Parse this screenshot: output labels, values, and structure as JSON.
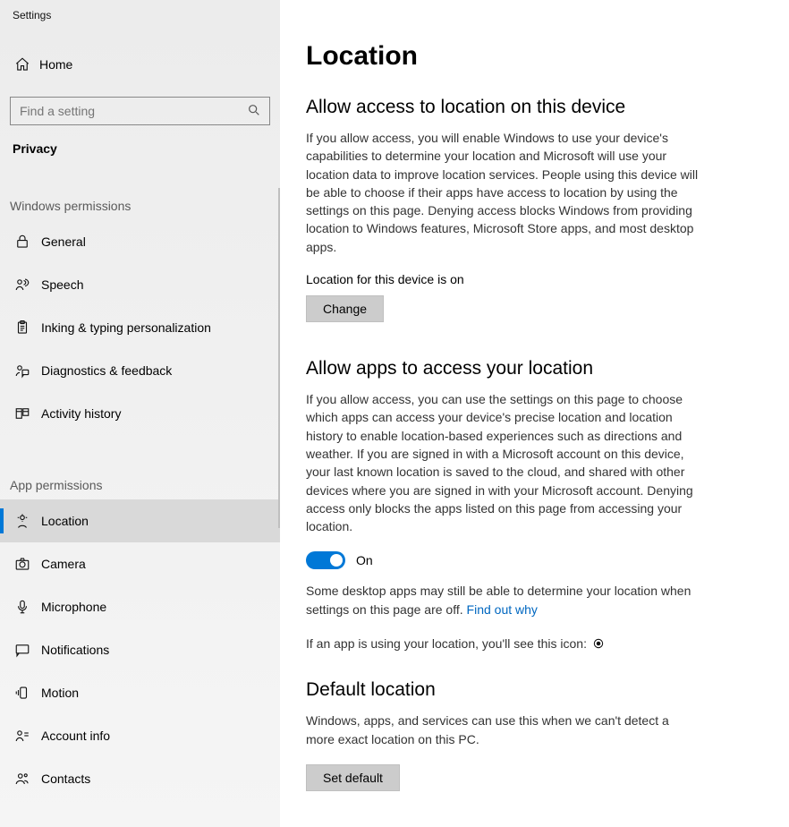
{
  "app_title": "Settings",
  "home_label": "Home",
  "search_placeholder": "Find a setting",
  "current_page": "Privacy",
  "groups": {
    "windows_permissions": {
      "header": "Windows permissions",
      "items": [
        "General",
        "Speech",
        "Inking & typing personalization",
        "Diagnostics & feedback",
        "Activity history"
      ]
    },
    "app_permissions": {
      "header": "App permissions",
      "items": [
        "Location",
        "Camera",
        "Microphone",
        "Notifications",
        "Motion",
        "Account info",
        "Contacts"
      ]
    }
  },
  "selected_item": "Location",
  "page": {
    "title": "Location",
    "section1": {
      "title": "Allow access to location on this device",
      "body": "If you allow access, you will enable Windows to use your device's capabilities to determine your location and Microsoft will use your location data to improve location services. People using this device will be able to choose if their apps have access to location by using the settings on this page. Denying access blocks Windows from providing location to Windows features, Microsoft Store apps, and most desktop apps.",
      "status": "Location for this device is on",
      "button": "Change"
    },
    "section2": {
      "title": "Allow apps to access your location",
      "body": "If you allow access, you can use the settings on this page to choose which apps can access your device's precise location and location history to enable location-based experiences such as directions and weather. If you are signed in with a Microsoft account on this device, your last known location is saved to the cloud, and shared with other devices where you are signed in with your Microsoft account. Denying access only blocks the apps listed on this page from accessing your location.",
      "toggle_state": "On",
      "note_prefix": "Some desktop apps may still be able to determine your location when settings on this page are off. ",
      "note_link": "Find out why",
      "icon_line": "If an app is using your location, you'll see this icon: "
    },
    "section3": {
      "title": "Default location",
      "body": "Windows, apps, and services can use this when we can't detect a more exact location on this PC.",
      "button": "Set default"
    }
  }
}
